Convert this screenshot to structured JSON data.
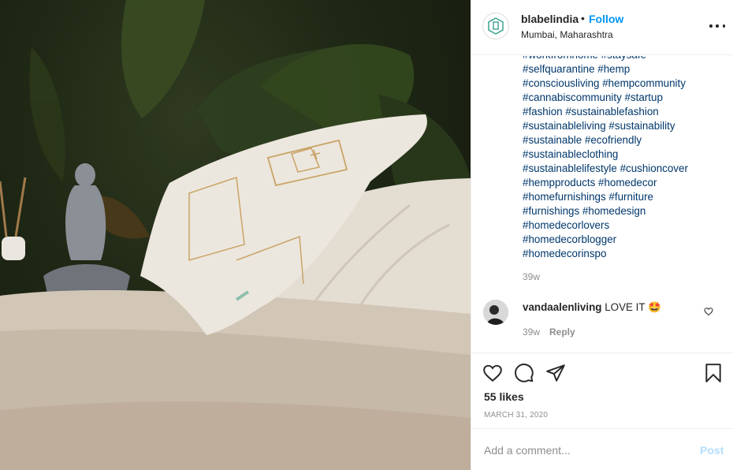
{
  "photo": {
    "alt_subject": "cushions-on-daybed"
  },
  "header": {
    "username": "blabelindia",
    "separator": "•",
    "follow_label": "Follow",
    "location": "Mumbai, Maharashtra",
    "more_icon": "more-horizontal-icon"
  },
  "caption": {
    "hashtag_lines": [
      "#workfromhome #staysafe",
      "#selfquarantine #hemp",
      "#consciousliving #hempcommunity",
      "#cannabiscommunity #startup",
      "#fashion #sustainablefashion",
      "#sustainableliving #sustainability",
      "#sustainable #ecofriendly",
      "#sustainableclothing",
      "#sustainablelifestyle #cushioncover",
      "#hempproducts #homedecor",
      "#homefurnishings #furniture",
      "#furnishings #homedesign",
      "#homedecorlovers",
      "#homedecorblogger",
      "#homedecorinspo"
    ],
    "time": "39w"
  },
  "comment": {
    "username": "vandaalenliving",
    "text": "LOVE IT 🤩",
    "time": "39w",
    "reply_label": "Reply"
  },
  "actions": {
    "likes": "55 likes",
    "date": "MARCH 31, 2020"
  },
  "add_comment": {
    "placeholder": "Add a comment...",
    "post_label": "Post"
  },
  "colors": {
    "link": "#00376b",
    "follow": "#0095f6",
    "muted": "#8e8e8e",
    "post_disabled": "#b2dffc"
  }
}
